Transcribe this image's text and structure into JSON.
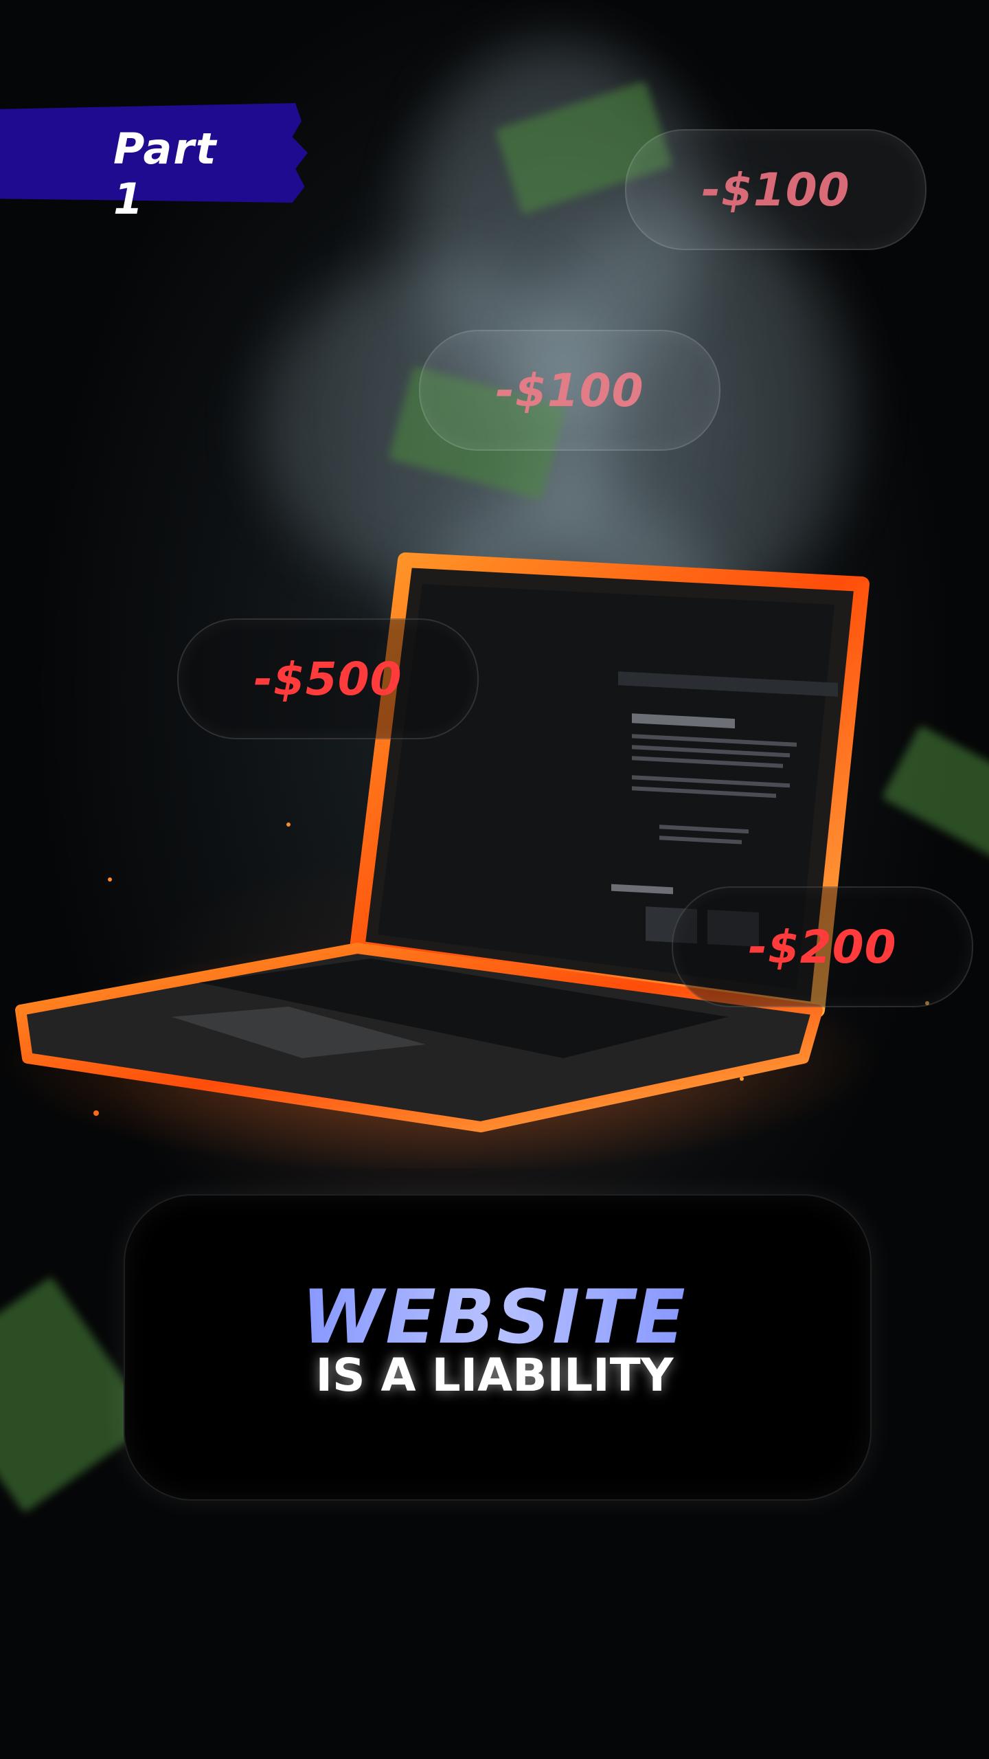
{
  "banner": {
    "label": "Part 1",
    "color": "#1e0b8f"
  },
  "cost_tags": [
    {
      "text": "-$100",
      "color": "#d96a78"
    },
    {
      "text": "-$100",
      "color": "#e27c86"
    },
    {
      "text": "-$500",
      "color": "#ff3b3b"
    },
    {
      "text": "-$200",
      "color": "#ff3b3b"
    }
  ],
  "title": {
    "main": "WEBSITE",
    "sub": "IS A LIABILITY",
    "accent": "#3c55ff"
  },
  "colors": {
    "background": "#050607",
    "fire": "#ff6a1a",
    "money": "#4c8a3e"
  }
}
